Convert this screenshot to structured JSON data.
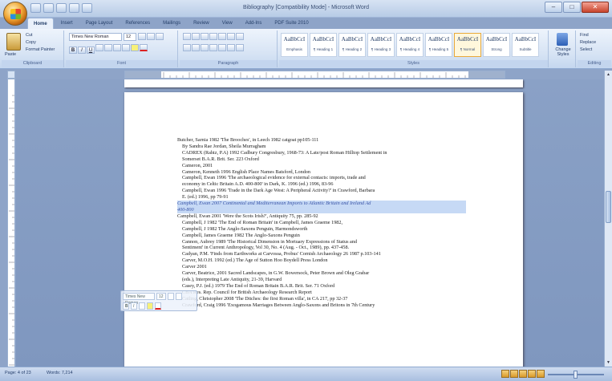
{
  "window": {
    "title": "Bibliography [Compatibility Mode] - Microsoft Word",
    "controls": {
      "minimize": "–",
      "maximize": "□",
      "close": "✕"
    }
  },
  "tabs": [
    "Home",
    "Insert",
    "Page Layout",
    "References",
    "Mailings",
    "Review",
    "View",
    "Add-Ins",
    "PDF Suite 2010"
  ],
  "ribbon": {
    "clipboard": {
      "paste": "Paste",
      "cut": "Cut",
      "copy": "Copy",
      "format_painter": "Format Painter",
      "label": "Clipboard"
    },
    "font": {
      "name": "Times New Roman",
      "size": "12",
      "label": "Font"
    },
    "paragraph": {
      "label": "Paragraph"
    },
    "styles": {
      "label": "Styles",
      "gallery": [
        {
          "sample": "AaBbCcI",
          "name": "Emphasis"
        },
        {
          "sample": "AaBbCcI",
          "name": "¶ Heading 1"
        },
        {
          "sample": "AaBbCcI",
          "name": "¶ Heading 2"
        },
        {
          "sample": "AaBbCcI",
          "name": "¶ Heading 3"
        },
        {
          "sample": "AaBbCcI",
          "name": "¶ Heading 4"
        },
        {
          "sample": "AaBbCcI",
          "name": "¶ Heading 5"
        },
        {
          "sample": "AaBbCcI",
          "name": "¶ Normal"
        },
        {
          "sample": "AaBbCcI",
          "name": "Strong"
        },
        {
          "sample": "AaBbCcI",
          "name": "Subtitle"
        }
      ],
      "change_styles": "Change Styles"
    },
    "editing": {
      "find": "Find",
      "replace": "Replace",
      "select": "Select",
      "label": "Editing"
    }
  },
  "document": {
    "entries": [
      {
        "text": "Butcher, Sarnia 1982 'The Brooches', in Leech 1982 catgoat pp105-111",
        "indent": false,
        "highlight": false
      },
      {
        "text": "By Sandra Rae Jordan, Sheila Murragham",
        "indent": true,
        "highlight": false
      },
      {
        "text": "CADREX (Rahtz, P.A) 1992 Cadbury Congresbury, 1968-73: A Late/post Roman Hilltop Settlement in",
        "indent": true,
        "highlight": false
      },
      {
        "text": "Somerset B.A.R. Brit. Ser. 223 Oxford",
        "indent": true,
        "highlight": false
      },
      {
        "text": "Cameron, 2001",
        "indent": true,
        "highlight": false
      },
      {
        "text": "Cameron, Kenneth 1996 English Place Names Batsford, London",
        "indent": true,
        "highlight": false
      },
      {
        "text": "Campbell, Ewan 1996 'The archaeological evidence for external contacts: imports, trade and",
        "indent": true,
        "highlight": false
      },
      {
        "text": "economy in Celtic Britain A.D. 400-800' in Dark, K. 1996 (ed.) 1996, 83-96",
        "indent": true,
        "highlight": false
      },
      {
        "text": "Campbell, Ewan 1996 'Trade in the Dark Age West: A Peripheral Activity?' in Crawford, Barbara",
        "indent": true,
        "highlight": false
      },
      {
        "text": "E. (ed.) 1996, pp 79-91",
        "indent": true,
        "highlight": false
      },
      {
        "text": "Campbell, Ewan 2007 Continental and Mediterranean Imports to Atlantic Britain and Ireland Ad",
        "indent": false,
        "highlight": true
      },
      {
        "text": "400-800",
        "indent": false,
        "highlight": true
      },
      {
        "text": "Campbell, Ewan 2001 'Were the Scots Irish?', Antiquity 75, pp. 285-92",
        "indent": false,
        "highlight": false
      },
      {
        "text": "Campbell, J 1982 'The End of Roman Britain' in Campbell, James Graeme 1982,",
        "indent": true,
        "highlight": false
      },
      {
        "text": "Campbell, J 1982 The Anglo-Saxons Penguin, Harmondsworth",
        "indent": true,
        "highlight": false
      },
      {
        "text": "Campbell, James Graeme 1982 The Anglo-Saxons Penguin",
        "indent": true,
        "highlight": false
      },
      {
        "text": "Cannon, Aubrey 1989 'The Historical Dimension in Mortuary Expressions of Status and",
        "indent": true,
        "highlight": false
      },
      {
        "text": "Sentiment' in Current Anthropology, Vol 30, No. 4 (Aug. - Oct., 1989), pp. 437-458.",
        "indent": true,
        "highlight": false
      },
      {
        "text": "Cadyan, P.M. 'Finds from Earthworks at Carvossa, Probus' Cornish Archaeology 26 1987 p.103-141",
        "indent": true,
        "highlight": false
      },
      {
        "text": "Carver, M.O.H. 1992 (ed.) The Age of Sutton Hoo Boydell Press London",
        "indent": true,
        "highlight": false
      },
      {
        "text": "Carver 2001",
        "indent": true,
        "highlight": false
      },
      {
        "text": "Carver, Beatrice, 2001 Sacred Landscapes, in G.W. Bowersock, Peter Brown and Oleg Grabar",
        "indent": true,
        "highlight": false
      },
      {
        "text": "(eds.), Interpreting Late Antiquity, 21-39, Harvard",
        "indent": true,
        "highlight": false
      },
      {
        "text": "Casey, P.J. (ed.) 1979 The End of Roman Britain B.A.R. Brit. Ser. 71 Oxford",
        "indent": true,
        "highlight": false
      },
      {
        "text": "CBA Res. Rep. Council for British Archaeology Research Report",
        "indent": true,
        "highlight": false
      },
      {
        "text": "Catling, Christopher 2008 'The Ditches: the first Roman villa', in CA 217, pp 32-37",
        "indent": true,
        "highlight": false
      },
      {
        "text": "Crawford, Craig 1996 'Exogamous Marriages Between Anglo-Saxons and Britons in 7th Century",
        "indent": true,
        "highlight": false
      }
    ],
    "mini_toolbar": {
      "font": "Times New Roman",
      "size": "12"
    }
  },
  "status": {
    "page": "Page: 4 of 23",
    "words": "Words: 7,214"
  }
}
